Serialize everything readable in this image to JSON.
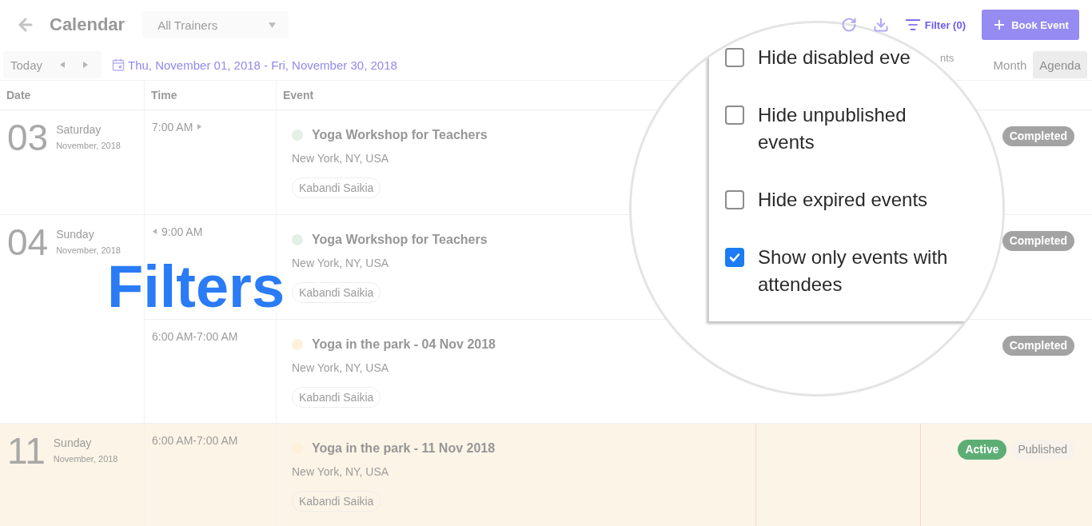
{
  "header": {
    "title": "Calendar",
    "trainer_select": {
      "value": "All Trainers"
    },
    "filter_button": {
      "label": "Filter (0)"
    },
    "book_button": {
      "label": "Book Event"
    }
  },
  "toolbar": {
    "today_button": {
      "label": "Today"
    },
    "date_range": "Thu, November 01, 2018 - Fri, November 30, 2018",
    "views": [
      {
        "label": "Month",
        "selected": false
      },
      {
        "label": "Agenda",
        "selected": true
      }
    ]
  },
  "filter_menu_fragment": "nts",
  "table": {
    "columns": [
      "Date",
      "Time",
      "Event"
    ],
    "groups": [
      {
        "day": "03",
        "weekday": "Saturday",
        "month": "November, 2018",
        "highlighted": false,
        "events": [
          {
            "time": "7:00 AM",
            "continues": true,
            "continued": false,
            "color": "#e3f0e6",
            "title": "Yoga Workshop for Teachers",
            "location": "New York, NY, USA",
            "trainer": "Kabandi Saikia",
            "statuses": [
              {
                "label": "Completed",
                "kind": "completed"
              }
            ]
          }
        ]
      },
      {
        "day": "04",
        "weekday": "Sunday",
        "month": "November, 2018",
        "highlighted": false,
        "events": [
          {
            "time": "9:00 AM",
            "continues": false,
            "continued": true,
            "color": "#e3f0e6",
            "title": "Yoga Workshop for Teachers",
            "location": "New York, NY, USA",
            "trainer": "Kabandi Saikia",
            "statuses": [
              {
                "label": "Completed",
                "kind": "completed"
              }
            ]
          },
          {
            "time": "6:00 AM-7:00 AM",
            "continues": false,
            "continued": false,
            "color": "#fff0d9",
            "title": "Yoga in the park - 04 Nov 2018",
            "location": "New York, NY, USA",
            "trainer": "Kabandi Saikia",
            "statuses": [
              {
                "label": "Completed",
                "kind": "completed"
              }
            ]
          }
        ]
      },
      {
        "day": "11",
        "weekday": "Sunday",
        "month": "November, 2018",
        "highlighted": true,
        "events": [
          {
            "time": "6:00 AM-7:00 AM",
            "continues": false,
            "continued": false,
            "color": "#fff0d9",
            "title": "Yoga in the park - 11 Nov 2018",
            "location": "New York, NY, USA",
            "trainer": "Kabandi Saikia",
            "statuses": [
              {
                "label": "Active",
                "kind": "active"
              },
              {
                "label": "Published",
                "kind": "published"
              }
            ]
          }
        ]
      }
    ]
  },
  "magnifier": {
    "options": [
      {
        "label": "Hide disabled eve",
        "checked": false
      },
      {
        "label": "Hide unpublished events",
        "checked": false
      },
      {
        "label": "Hide expired events",
        "checked": false
      },
      {
        "label": "Show only events with attendees",
        "checked": true
      }
    ]
  },
  "caption": "Filters"
}
